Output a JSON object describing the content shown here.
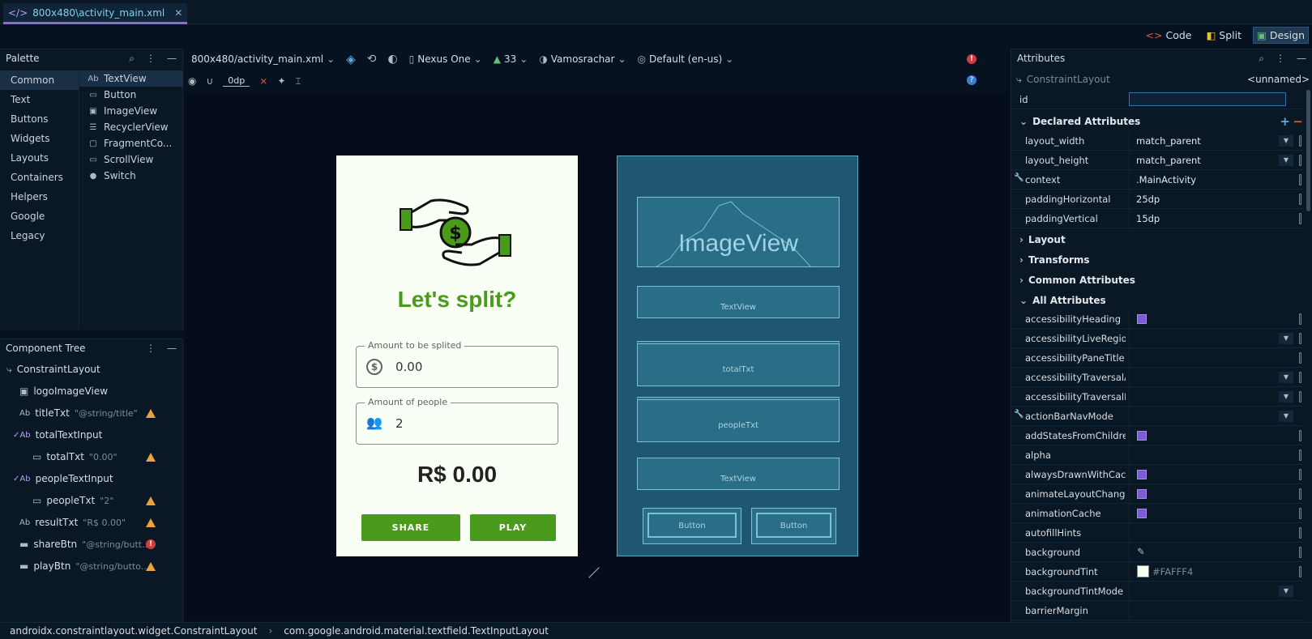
{
  "file_tab": {
    "label": "800x480\\activity_main.xml"
  },
  "modes": {
    "code": "Code",
    "split": "Split",
    "design": "Design"
  },
  "palette": {
    "title": "Palette",
    "categories": [
      "Common",
      "Text",
      "Buttons",
      "Widgets",
      "Layouts",
      "Containers",
      "Helpers",
      "Google",
      "Legacy"
    ],
    "items": [
      {
        "icon": "Ab",
        "label": "TextView"
      },
      {
        "icon": "▭",
        "label": "Button"
      },
      {
        "icon": "▣",
        "label": "ImageView"
      },
      {
        "icon": "☰",
        "label": "RecyclerView"
      },
      {
        "icon": "▢",
        "label": "FragmentCo..."
      },
      {
        "icon": "▭",
        "label": "ScrollView"
      },
      {
        "icon": "●",
        "label": "Switch"
      }
    ]
  },
  "tree": {
    "title": "Component Tree",
    "nodes": [
      {
        "name": "ConstraintLayout",
        "hint": ""
      },
      {
        "name": "logoImageView",
        "hint": ""
      },
      {
        "name": "titleTxt",
        "hint": "\"@string/title\""
      },
      {
        "name": "totalTextInput",
        "hint": ""
      },
      {
        "name": "totalTxt",
        "hint": "\"0.00\""
      },
      {
        "name": "peopleTextInput",
        "hint": ""
      },
      {
        "name": "peopleTxt",
        "hint": "\"2\""
      },
      {
        "name": "resultTxt",
        "hint": "\"R$ 0.00\""
      },
      {
        "name": "shareBtn",
        "hint": "\"@string/butt..."
      },
      {
        "name": "playBtn",
        "hint": "\"@string/butto..."
      }
    ]
  },
  "toolbar": {
    "file": "800x480/activity_main.xml",
    "device": "Nexus One",
    "api": "33",
    "theme": "Vamosrachar",
    "locale": "Default (en-us)",
    "margin": "0dp"
  },
  "device": {
    "title": "Let's split?",
    "amount_label": "Amount to be splited",
    "amount_value": "0.00",
    "people_label": "Amount of people",
    "people_value": "2",
    "result": "R$ 0.00",
    "share_btn": "SHARE",
    "play_btn": "PLAY"
  },
  "blueprint": {
    "image": "ImageView",
    "text1": "TextView",
    "total": "totalTxt",
    "people": "peopleTxt",
    "text2": "TextView",
    "btn1": "Button",
    "btn2": "Button"
  },
  "attributes": {
    "title": "Attributes",
    "component": "ConstraintLayout",
    "component_id": "<unnamed>",
    "id_label": "id",
    "declared_title": "Declared Attributes",
    "declared": [
      {
        "name": "layout_width",
        "value": "match_parent"
      },
      {
        "name": "layout_height",
        "value": "match_parent"
      },
      {
        "name": "context",
        "value": ".MainActivity"
      },
      {
        "name": "paddingHorizontal",
        "value": "25dp"
      },
      {
        "name": "paddingVertical",
        "value": "15dp"
      }
    ],
    "sections": [
      "Layout",
      "Transforms",
      "Common Attributes"
    ],
    "all_title": "All Attributes",
    "all": [
      {
        "name": "accessibilityHeading",
        "value": ""
      },
      {
        "name": "accessibilityLiveRegion",
        "value": ""
      },
      {
        "name": "accessibilityPaneTitle",
        "value": ""
      },
      {
        "name": "accessibilityTraversalAf...",
        "value": ""
      },
      {
        "name": "accessibilityTraversalB...",
        "value": ""
      },
      {
        "name": "actionBarNavMode",
        "value": ""
      },
      {
        "name": "addStatesFromChildren",
        "value": ""
      },
      {
        "name": "alpha",
        "value": ""
      },
      {
        "name": "alwaysDrawnWithCache",
        "value": ""
      },
      {
        "name": "animateLayoutChanges",
        "value": ""
      },
      {
        "name": "animationCache",
        "value": ""
      },
      {
        "name": "autofillHints",
        "value": ""
      },
      {
        "name": "background",
        "value": ""
      },
      {
        "name": "backgroundTint",
        "value": "#FAFFF4"
      },
      {
        "name": "backgroundTintMode",
        "value": ""
      },
      {
        "name": "barrierMargin",
        "value": ""
      }
    ]
  },
  "status": {
    "crumb1": "androidx.constraintlayout.widget.ConstraintLayout",
    "crumb2": "com.google.android.material.textfield.TextInputLayout"
  },
  "colors": {
    "accent": "#4a9a1c",
    "purple": "#7b5cd6",
    "background": "#06121f"
  }
}
